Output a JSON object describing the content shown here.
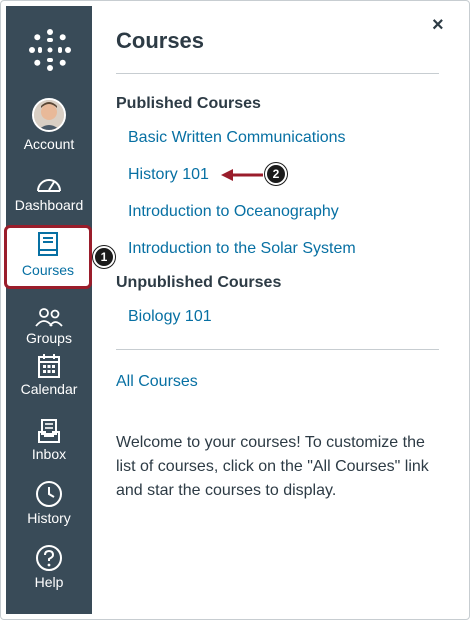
{
  "sidebar": {
    "logo_icon": "canvas-logo-icon",
    "items": [
      {
        "label": "Account",
        "icon": "avatar"
      },
      {
        "label": "Dashboard",
        "icon": "dashboard-icon"
      },
      {
        "label": "Courses",
        "icon": "courses-icon",
        "active": true
      },
      {
        "label": "Groups",
        "icon": "groups-icon"
      },
      {
        "label": "Calendar",
        "icon": "calendar-icon"
      },
      {
        "label": "Inbox",
        "icon": "inbox-icon"
      },
      {
        "label": "History",
        "icon": "history-icon"
      },
      {
        "label": "Help",
        "icon": "help-icon"
      }
    ]
  },
  "tray": {
    "title": "Courses",
    "close_label": "×",
    "published_heading": "Published Courses",
    "published": [
      "Basic Written Communications",
      "History 101",
      "Introduction to Oceanography",
      "Introduction to the Solar System"
    ],
    "unpublished_heading": "Unpublished Courses",
    "unpublished": [
      "Biology 101"
    ],
    "all_courses_link": "All Courses",
    "welcome_text": "Welcome to your courses! To customize the list of courses, click on the \"All Courses\" link and star the courses to display."
  },
  "annotations": {
    "badge_1": "1",
    "badge_2": "2"
  },
  "colors": {
    "sidebar_bg": "#394b58",
    "link": "#0770a3",
    "highlight": "#9a1d2b"
  }
}
